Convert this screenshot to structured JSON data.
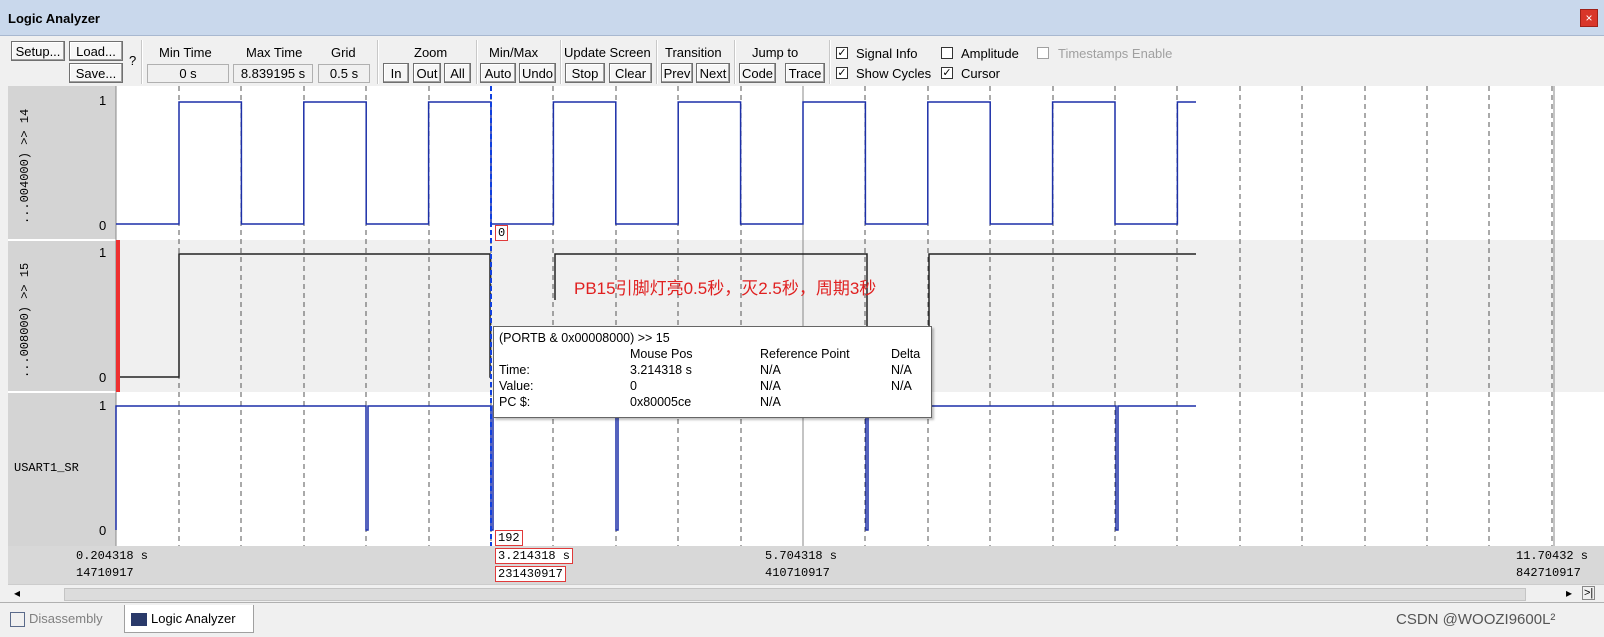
{
  "window": {
    "title": "Logic Analyzer",
    "close_label": "×"
  },
  "toolbar": {
    "setup": "Setup...",
    "load": "Load...",
    "save": "Save...",
    "help": "?",
    "min_time_label": "Min Time",
    "min_time_value": "0 s",
    "max_time_label": "Max Time",
    "max_time_value": "8.839195 s",
    "grid_label": "Grid",
    "grid_value": "0.5 s",
    "zoom_label": "Zoom",
    "zoom_in": "In",
    "zoom_out": "Out",
    "zoom_all": "All",
    "minmax_label": "Min/Max",
    "auto": "Auto",
    "undo": "Undo",
    "update_label": "Update Screen",
    "stop": "Stop",
    "clear": "Clear",
    "transition_label": "Transition",
    "prev": "Prev",
    "next": "Next",
    "jump_label": "Jump to",
    "code": "Code",
    "trace": "Trace",
    "signal_info": "Signal Info",
    "show_cycles": "Show Cycles",
    "amplitude": "Amplitude",
    "cursor": "Cursor",
    "timestamps": "Timestamps Enable",
    "check_mark": "✓"
  },
  "signals": [
    {
      "name": "...004000) >> 14",
      "high": "1",
      "low": "0"
    },
    {
      "name": "...008000) >> 15",
      "high": "1",
      "low": "0"
    },
    {
      "name": "USART1_SR",
      "high": "1",
      "low": "0"
    }
  ],
  "cursor_labels": {
    "s1": "0",
    "s3": "192"
  },
  "annotation": "PB15引脚灯亮0.5秒，灭2.5秒，周期3秒",
  "popup": {
    "title": "(PORTB & 0x00008000) >> 15",
    "col_mouse": "Mouse Pos",
    "col_ref": "Reference Point",
    "col_delta": "Delta",
    "time_label": "Time:",
    "time_mouse": "3.214318 s",
    "time_ref": "N/A",
    "time_delta": "N/A",
    "value_label": "Value:",
    "value_mouse": "0",
    "value_ref": "N/A",
    "value_delta": "N/A",
    "pc_label": "PC $:",
    "pc_mouse": "0x80005ce",
    "pc_ref": "N/A"
  },
  "timeline": {
    "left_time": "0.204318 s",
    "left_cycles": "14710917",
    "cursor_time": "3.214318 s",
    "cursor_cycles": "231430917",
    "mid_time": "5.704318 s",
    "mid_cycles": "410710917",
    "right_time": "11.70432 s",
    "right_cycles": "842710917"
  },
  "scrollbar": {
    "left": "◂",
    "right": "▸",
    "end": ">|"
  },
  "tabs": {
    "disassembly": "Disassembly",
    "logic": "Logic Analyzer"
  },
  "watermark": "CSDN @WOOZI9600L²",
  "colors": {
    "signal": "#1c2fa8",
    "black_signal": "#222222",
    "cursor": "#1040e0",
    "annotation": "#e02020"
  }
}
